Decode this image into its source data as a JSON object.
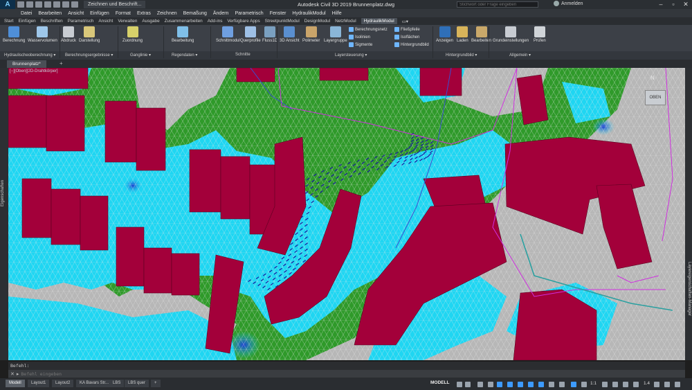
{
  "titlebar": {
    "logo": "A",
    "doc_tab": "Zeichnen und Beschrift...",
    "title": "Autodesk Civil 3D 2019   Brunnenplatz.dwg",
    "search_placeholder": "Stichwort oder Frage eingeben",
    "login": "Anmelden"
  },
  "menu": [
    "Datei",
    "Bearbeiten",
    "Ansicht",
    "Einfügen",
    "Format",
    "Extras",
    "Zeichnen",
    "Bemaßung",
    "Ändern",
    "Parametrisch",
    "Fenster",
    "HydraulikModul",
    "Hilfe"
  ],
  "ribbon_tabs": [
    {
      "label": "Start",
      "active": false
    },
    {
      "label": "Einfügen",
      "active": false
    },
    {
      "label": "Beschriften",
      "active": false
    },
    {
      "label": "Parametrisch",
      "active": false
    },
    {
      "label": "Ansicht",
      "active": false
    },
    {
      "label": "Verwalten",
      "active": false
    },
    {
      "label": "Ausgabe",
      "active": false
    },
    {
      "label": "Zusammenarbeiten",
      "active": false
    },
    {
      "label": "Add-ins",
      "active": false
    },
    {
      "label": "Verfügbare Apps",
      "active": false
    },
    {
      "label": "StreetpunktModul",
      "active": false
    },
    {
      "label": "DesignModul",
      "active": false
    },
    {
      "label": "NetzModul",
      "active": false
    },
    {
      "label": "HydraulikModul",
      "active": true
    }
  ],
  "ribbon": {
    "buttons": [
      {
        "id": "berechnung",
        "label": "Berechnung",
        "icon": "calculation-icon",
        "color": "#4f8fd8"
      },
      {
        "id": "wasservolumen",
        "label": "Wasservolumen",
        "icon": "water-volume-icon",
        "color": "#9ec7ea"
      },
      {
        "id": "abdruck",
        "label": "Abdruck",
        "icon": "print-icon",
        "color": "#c8ccd2"
      },
      {
        "id": "darstellung",
        "label": "Darstellung",
        "icon": "display-icon",
        "color": "#d9c77a"
      },
      {
        "id": "zuordnung",
        "label": "Zuordnung",
        "icon": "assignment-icon",
        "color": "#d6d06a"
      },
      {
        "id": "bearbeitung",
        "label": "Bearbeitung",
        "icon": "edit-icon",
        "color": "#7fbfe8"
      },
      {
        "id": "schnittmodul",
        "label": "Schnittmodul",
        "icon": "section-module-icon",
        "color": "#6f9fe0"
      },
      {
        "id": "querprofile",
        "label": "Querprofile",
        "icon": "cross-profile-icon",
        "color": "#9ec0e6"
      },
      {
        "id": "fluss1d",
        "label": "Fluss1D",
        "icon": "river-1d-icon",
        "color": "#7aa0c0"
      },
      {
        "id": "3dansicht",
        "label": "3D Ansicht",
        "icon": "3d-view-icon",
        "color": "#5a8fd0"
      },
      {
        "id": "polimeter",
        "label": "Polimeter",
        "icon": "hammer-icon",
        "color": "#c9a46a"
      },
      {
        "id": "layergruppe",
        "label": "Layergruppe",
        "icon": "layer-group-icon",
        "color": "#8ab6d8"
      },
      {
        "id": "anzeigen",
        "label": "Anzeigen",
        "icon": "show-icon",
        "color": "#2f6fb8"
      },
      {
        "id": "laden",
        "label": "Laden",
        "icon": "load-icon",
        "color": "#d8b45a"
      },
      {
        "id": "bearbeiten2",
        "label": "Bearbeiten",
        "icon": "edit-icon",
        "color": "#c9a86a"
      },
      {
        "id": "grundeinstellungen",
        "label": "Grundeinstellungen",
        "icon": "settings-icon",
        "color": "#c8ccd2"
      },
      {
        "id": "pruefen",
        "label": "Prüfen",
        "icon": "check-icon",
        "color": "#d0d4d8"
      }
    ],
    "small_buttons": [
      {
        "label": "Berechnungsnetz",
        "icon": "mesh-icon"
      },
      {
        "label": "Isolinien",
        "icon": "isoline-icon"
      },
      {
        "label": "Sigmente",
        "icon": "segment-icon"
      },
      {
        "label": "Fließpfeile",
        "icon": "flow-arrow-icon"
      },
      {
        "label": "Isoflächen",
        "icon": "isoarea-icon"
      },
      {
        "label": "Hintergrundbild",
        "icon": "background-image-icon"
      }
    ],
    "groups": [
      "Hydraulischeoberechnung ▾",
      "Berechnungsergebnisse ▾",
      "Ganglinie ▾",
      "Regendaten ▾",
      "Schnitte",
      "Layersteuerung ▾",
      "Hintergrundbild ▾",
      "Allgemein ▾"
    ]
  },
  "file_tab": "Brunnenplatz*",
  "viewport_label": "[−][Oben][2D-Drahtkörper]",
  "viewcube_label": "OBEN",
  "compass_label": "N",
  "left_palette": "Eigenschaften",
  "right_palette": "Layereigenschaften-Manager",
  "command": {
    "history": "Befehl:",
    "placeholder": "Befehl eingeben"
  },
  "status": {
    "layout_tabs": [
      {
        "label": "Modell",
        "active": true
      },
      {
        "label": "Layout1",
        "active": false
      },
      {
        "label": "Layout2",
        "active": false
      },
      {
        "label": "KA Bavars Str...",
        "active": false
      },
      {
        "label": "LBS",
        "active": false
      },
      {
        "label": "LBS quer",
        "active": false
      }
    ],
    "model_label": "MODELL",
    "scale": "1:1",
    "zoom": "1.4"
  },
  "colors": {
    "building": "#a3003a",
    "grass": "#2f9a2a",
    "water": "#1fd6f2",
    "deep_water": "#2d6bd8",
    "paved": "#b9b9b9",
    "mesh": "#e6e6e6"
  }
}
